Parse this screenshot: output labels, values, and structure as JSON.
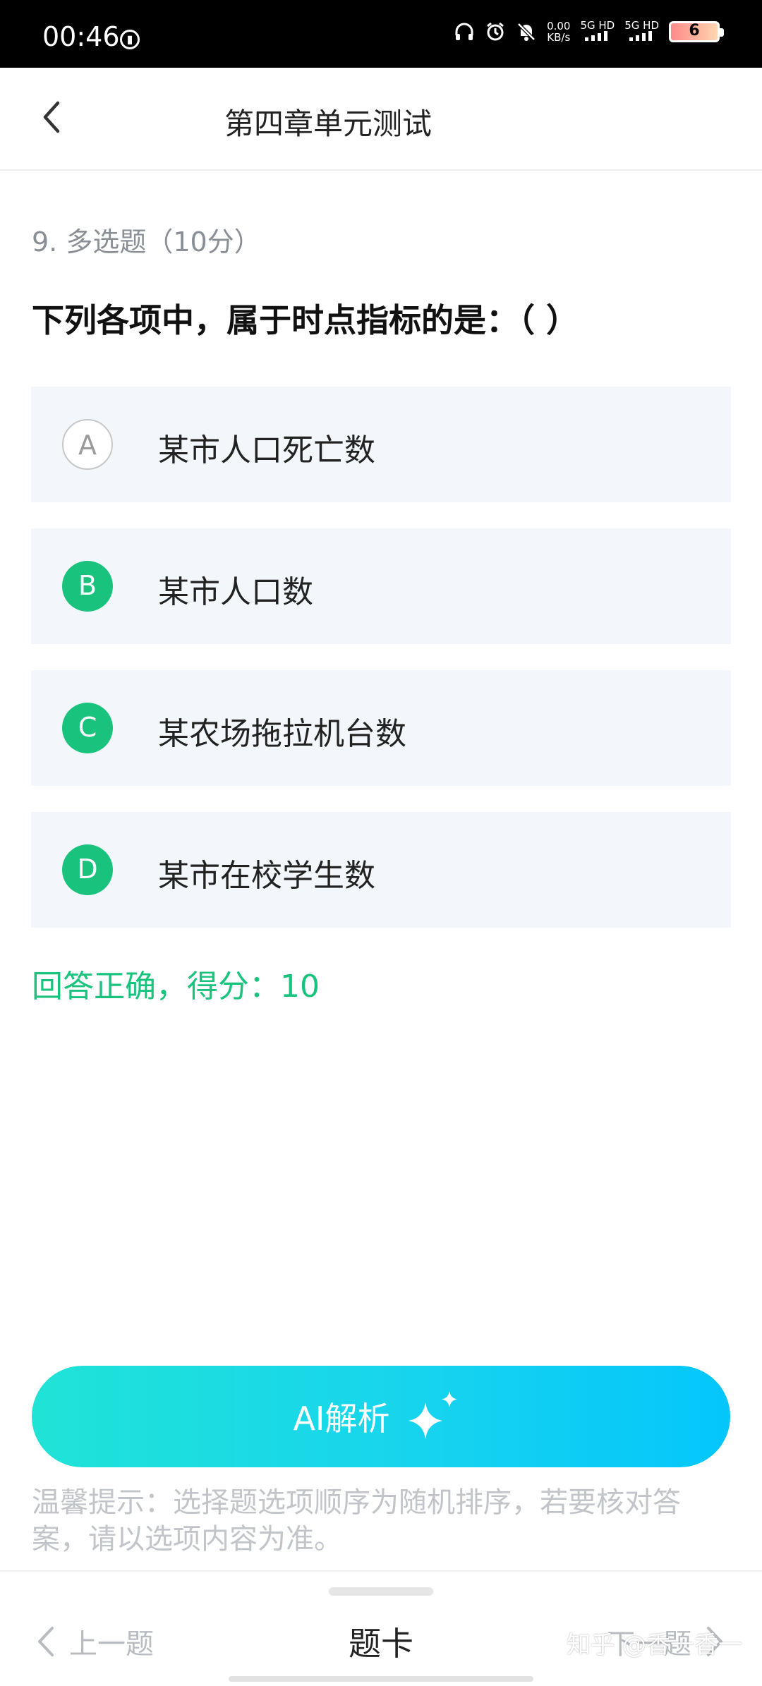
{
  "status_bar": {
    "time": "00:46",
    "speed_value": "0.00",
    "speed_unit": "KB/s",
    "net1": "5G HD",
    "net2": "5G HD",
    "battery": "6"
  },
  "header": {
    "title": "第四章单元测试"
  },
  "question": {
    "meta": "9. 多选题（10分）",
    "text": "下列各项中，属于时点指标的是：（ ）"
  },
  "options": [
    {
      "letter": "A",
      "text": "某市人口死亡数",
      "selected": false
    },
    {
      "letter": "B",
      "text": "某市人口数",
      "selected": true
    },
    {
      "letter": "C",
      "text": "某农场拖拉机台数",
      "selected": true
    },
    {
      "letter": "D",
      "text": "某市在校学生数",
      "selected": true
    }
  ],
  "result_text": "回答正确，得分：10",
  "ai_button": {
    "label": "AI解析"
  },
  "hint": "温馨提示：选择题选项顺序为随机排序，若要核对答案，请以选项内容为准。",
  "bottom": {
    "prev_label": "上一题",
    "card_label": "题卡",
    "next_label": "下一题"
  },
  "watermark": "知乎 @香一香一",
  "colors": {
    "accent_green": "#19c37d",
    "ai_gradient_start": "#20e3d6",
    "ai_gradient_end": "#04c6fb",
    "option_bg": "#f3f7fb"
  },
  "icons": {
    "back": "chevron-left-icon",
    "sparkle": "sparkle-icon",
    "prev": "chevron-left-icon",
    "next": "chevron-right-icon"
  }
}
